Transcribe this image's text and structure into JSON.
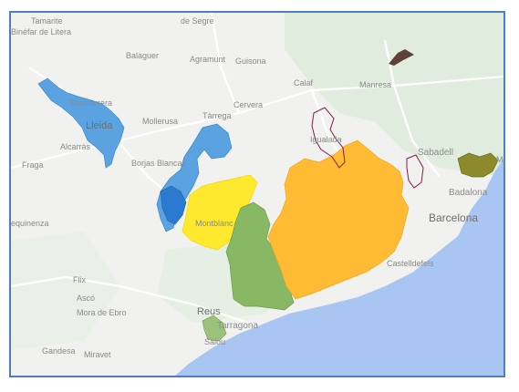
{
  "map": {
    "colors": {
      "land": "#f1f1ef",
      "sea": "#a9c6f2",
      "road": "#ffffff",
      "green_area": "#d8ecd6",
      "blue_region": "#4f9fe0",
      "blue_region_dark": "#2d7ccf",
      "yellow_region": "#ffe92e",
      "green_region": "#84b860",
      "orange_region": "#ffb92c",
      "olive_region": "#8a8a25",
      "brown_region": "#5d4038",
      "purple_outline": "#8a1a4a",
      "frame": "#4a7fc1"
    },
    "places": [
      {
        "id": "tamarite",
        "text": "Tamarite"
      },
      {
        "id": "binefar",
        "text": "Binéfar de Litera"
      },
      {
        "id": "segre",
        "text": "de Segre"
      },
      {
        "id": "balaguer",
        "text": "Balaguer"
      },
      {
        "id": "agramunt",
        "text": "Agramunt"
      },
      {
        "id": "guisona",
        "text": "Guisona"
      },
      {
        "id": "calaf",
        "text": "Calaf"
      },
      {
        "id": "manresa",
        "text": "Manresa"
      },
      {
        "id": "torrefarrera",
        "text": "Torrefarrera"
      },
      {
        "id": "lleida",
        "text": "Lleida"
      },
      {
        "id": "mollerusa",
        "text": "Mollerusa"
      },
      {
        "id": "tarrega",
        "text": "Tàrrega"
      },
      {
        "id": "cervera",
        "text": "Cervera"
      },
      {
        "id": "igualada",
        "text": "Igualada"
      },
      {
        "id": "alcarras",
        "text": "Alcarràs"
      },
      {
        "id": "fraga",
        "text": "Fraga"
      },
      {
        "id": "borjas",
        "text": "Borjas Blancas"
      },
      {
        "id": "sabadell",
        "text": "Sabadell"
      },
      {
        "id": "badalona",
        "text": "Badalona"
      },
      {
        "id": "mequinenza",
        "text": "equinenza"
      },
      {
        "id": "montblanc",
        "text": "Montblanc"
      },
      {
        "id": "flix",
        "text": "Flix"
      },
      {
        "id": "asco",
        "text": "Ascó"
      },
      {
        "id": "castelldefels",
        "text": "Castelldefels"
      },
      {
        "id": "reus",
        "text": "Reus"
      },
      {
        "id": "tarragona",
        "text": "Tarragona"
      },
      {
        "id": "mora",
        "text": "Mora de Ebro"
      },
      {
        "id": "gandesa",
        "text": "Gandesa"
      },
      {
        "id": "miravet",
        "text": "Miravet"
      },
      {
        "id": "salou",
        "text": "Salou"
      },
      {
        "id": "m",
        "text": "M"
      }
    ],
    "cities": [
      {
        "id": "barcelona",
        "text": "Barcelona"
      }
    ]
  }
}
